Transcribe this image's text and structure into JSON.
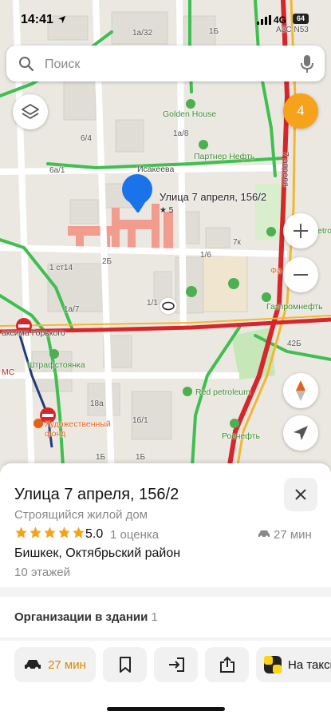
{
  "status_bar": {
    "time": "14:41",
    "network": "4G",
    "battery": "64"
  },
  "search": {
    "placeholder": "Поиск"
  },
  "map": {
    "badge_count": "4",
    "pin": {
      "title": "Улица 7 апреля, 156/2",
      "rating": "★ 5"
    },
    "labels": {
      "addr_1a32": "1а/32",
      "addr_1b_top": "1Б",
      "addr_a3cn53": "АЗС N53",
      "addr_6_4": "6/4",
      "addr_1a8": "1а/8",
      "addr_6a1": "6а/1",
      "addr_2b": "2Б",
      "addr_1_6": "1/6",
      "addr_7k": "7к",
      "addr_1ct14": "1 ст14",
      "addr_1a7": "1а/7",
      "addr_1_1": "1/1",
      "addr_42b": "42Б",
      "addr_18a": "18а",
      "addr_16_1": "1б/1",
      "addr_1b_bottom": "1Б",
      "addr_1b_bottom2": "1Б",
      "street_isakeeva": "Исакеева",
      "street_7aprelya": "7 апреля",
      "street_gorkogo": "аксима Горького",
      "poi_golden_house": "Golden House",
      "poi_partner_neft": "Партнер Нефть",
      "poi_petro": "etro",
      "poi_fa": "Фа",
      "poi_gazpromneft": "Газпромнефть",
      "poi_shtrafstoyanka": "Штрафстоянка",
      "poi_ms": "МС",
      "poi_red_petroleum": "Red petroleum",
      "poi_art_fund": "Художественный фонд",
      "poi_rosneft": "Роснефть"
    }
  },
  "card": {
    "title": "Улица 7 апреля, 156/2",
    "subtitle": "Строящийся жилой дом",
    "rating": "5.0",
    "reviews": "1 оценка",
    "eta": "27 мин",
    "address": "Бишкек, Октябрьский район",
    "floors": "10 этажей",
    "orgs_label": "Организации в здании",
    "orgs_count": "1",
    "actions": {
      "route_label": "27 мин",
      "taxi_label": "На такси"
    }
  },
  "colors": {
    "accent_orange": "#f7a21b",
    "pin_blue": "#1a73e8",
    "route_label": "#d48a00",
    "traffic_green": "#3fbf4f",
    "traffic_red": "#d7262b"
  }
}
